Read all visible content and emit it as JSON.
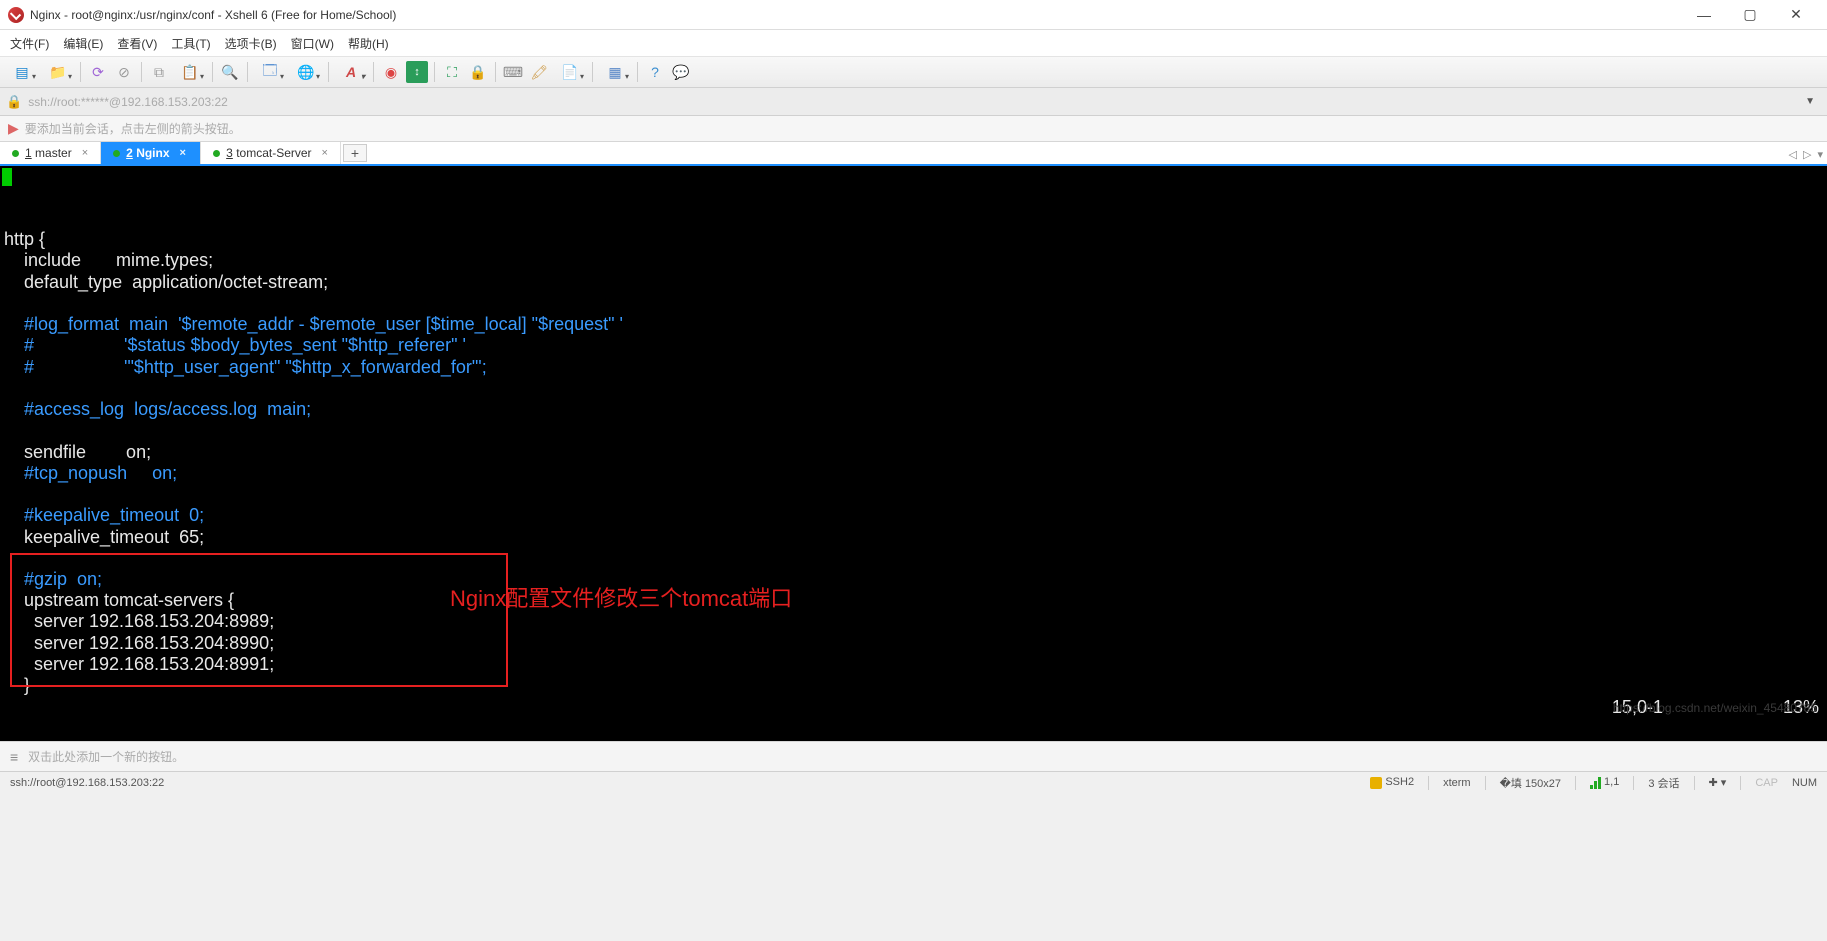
{
  "window": {
    "title": "Nginx - root@nginx:/usr/nginx/conf - Xshell 6 (Free for Home/School)"
  },
  "menu": {
    "file": "文件(F)",
    "edit": "编辑(E)",
    "view": "查看(V)",
    "tools": "工具(T)",
    "tabs": "选项卡(B)",
    "window": "窗口(W)",
    "help": "帮助(H)"
  },
  "addressbar": {
    "url": "ssh://root:******@192.168.153.203:22"
  },
  "hint": {
    "text": "要添加当前会话，点击左侧的箭头按钮。"
  },
  "tabs": [
    {
      "index": "1",
      "label": "master",
      "active": false
    },
    {
      "index": "2",
      "label": "Nginx",
      "active": true
    },
    {
      "index": "3",
      "label": "tomcat-Server",
      "active": false
    }
  ],
  "terminal": {
    "lines": [
      {
        "t": "",
        "c": false
      },
      {
        "t": "http {",
        "c": false
      },
      {
        "t": "    include       mime.types;",
        "c": false
      },
      {
        "t": "    default_type  application/octet-stream;",
        "c": false
      },
      {
        "t": "",
        "c": false
      },
      {
        "t": "    #log_format  main  '$remote_addr - $remote_user [$time_local] \"$request\" '",
        "c": true
      },
      {
        "t": "    #                  '$status $body_bytes_sent \"$http_referer\" '",
        "c": true
      },
      {
        "t": "    #                  '\"$http_user_agent\" \"$http_x_forwarded_for\"';",
        "c": true
      },
      {
        "t": "",
        "c": false
      },
      {
        "t": "    #access_log  logs/access.log  main;",
        "c": true
      },
      {
        "t": "",
        "c": false
      },
      {
        "t": "    sendfile        on;",
        "c": false
      },
      {
        "t": "    #tcp_nopush     on;",
        "c": true
      },
      {
        "t": "",
        "c": false
      },
      {
        "t": "    #keepalive_timeout  0;",
        "c": true
      },
      {
        "t": "    keepalive_timeout  65;",
        "c": false
      },
      {
        "t": "",
        "c": false
      },
      {
        "t": "    #gzip  on;",
        "c": true
      },
      {
        "t": "    upstream tomcat-servers {",
        "c": false
      },
      {
        "t": "      server 192.168.153.204:8989;",
        "c": false
      },
      {
        "t": "      server 192.168.153.204:8990;",
        "c": false
      },
      {
        "t": "      server 192.168.153.204:8991;",
        "c": false
      },
      {
        "t": "    }",
        "c": false
      }
    ],
    "annotation": "Nginx配置文件修改三个tomcat端口",
    "cursor_pos": "15,0-1",
    "scroll_pct": "13%",
    "watermark": "https://blog.csdn.net/weixin_45480785"
  },
  "bottombar": {
    "hint": "双击此处添加一个新的按钮。"
  },
  "statusbar": {
    "path": "ssh://root@192.168.153.203:22",
    "proto": "SSH2",
    "term": "xterm",
    "size": "150x27",
    "sig": "1,1",
    "sessions": "3 会话",
    "cap": "CAP",
    "num": "NUM"
  }
}
